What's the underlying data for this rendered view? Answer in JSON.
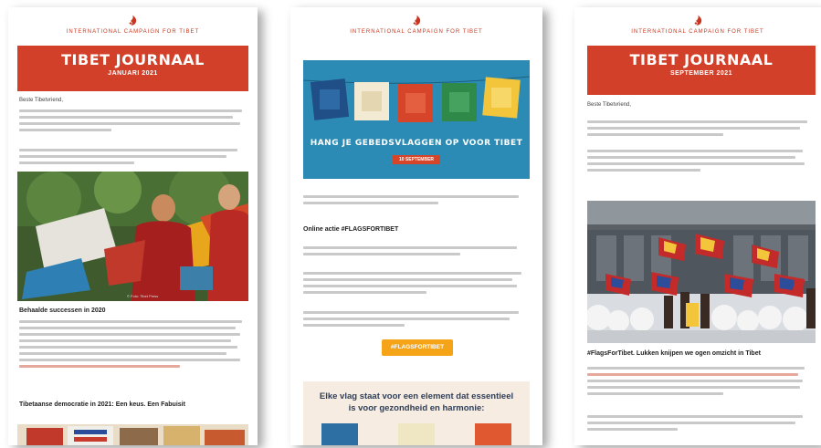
{
  "org_name": "INTERNATIONAL CAMPAIGN FOR TIBET",
  "newsletters": [
    {
      "banner_title": "TIBET JOURNAAL",
      "banner_subtitle": "JANUARI 2021",
      "greeting": "Beste Tibetvriend,",
      "photo_credit": "© Foto: Tibet Press",
      "section_1": "Behaalde successen in 2020",
      "section_2": "Tibetaanse democratie in 2021: Een keus. Een Fabuisit",
      "colors": {
        "accent": "#d2402a"
      }
    },
    {
      "hero_title": "HANG JE GEBEDSVLAGGEN OP VOOR TIBET",
      "hero_badge": "10 SEPTEMBER",
      "section_1": "Online actie #FLAGSFORTIBET",
      "button_label": "#FLAGSFORTIBET",
      "callout_text": "Elke vlag staat voor een element dat essentieel is voor gezondheid en harmonie:",
      "colors": {
        "hero_bg": "#2c8bb4",
        "button": "#f5a418",
        "callout_bg": "#f6ece2"
      }
    },
    {
      "banner_title": "TIBET JOURNAAL",
      "banner_subtitle": "SEPTEMBER 2021",
      "greeting": "Beste Tibetvriend,",
      "caption": "#FlagsForTibet. Lukken knijpen we ogen omzicht in Tibet",
      "colors": {
        "accent": "#d2402a"
      }
    }
  ]
}
